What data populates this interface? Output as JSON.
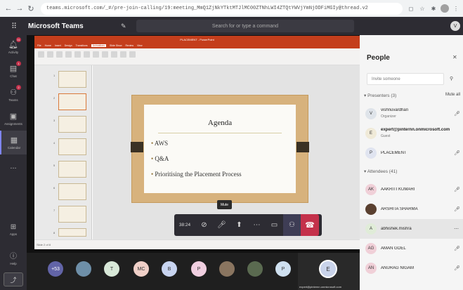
{
  "browser": {
    "url": "teams.microsoft.com/_#/pre-join-calling/19:meeting_MmQ1ZjNkYTktMTJlMC00ZTNhLWI4ZTQtYWVjYmNjODFiMGIy@thread.v2"
  },
  "teams_header": {
    "app_title": "Microsoft Teams",
    "search_placeholder": "Search for or type a command",
    "user_initial": "V"
  },
  "rail": {
    "items": [
      {
        "label": "Activity",
        "icon": "bell-icon",
        "badge": "11"
      },
      {
        "label": "Chat",
        "icon": "chat-icon",
        "badge": "1"
      },
      {
        "label": "Teams",
        "icon": "teams-icon",
        "badge": "2"
      },
      {
        "label": "Assignments",
        "icon": "assignments-icon",
        "badge": ""
      },
      {
        "label": "Calendar",
        "icon": "calendar-icon",
        "badge": ""
      },
      {
        "label": "...",
        "icon": "more-icon",
        "badge": ""
      }
    ],
    "apps_label": "Apps",
    "help_label": "Help"
  },
  "ppt": {
    "title_text": "PLACEMENT - PowerPoint",
    "tabs": [
      "File",
      "Home",
      "Insert",
      "Design",
      "Transitions",
      "Animations",
      "Slide Show",
      "Review",
      "View"
    ],
    "active_tab": "Animations",
    "thumbnails": [
      "1",
      "2",
      "3",
      "4",
      "5",
      "6",
      "7",
      "8"
    ],
    "status_text": "Slide 2 of 8"
  },
  "slide": {
    "title": "Agenda",
    "bullets": [
      "AWS",
      "Q&A",
      "Prioritising the Placement Process"
    ]
  },
  "call_controls": {
    "timer": "38:24",
    "tooltip": "Mute"
  },
  "strip": {
    "overflow_count": "+53",
    "bubbles": [
      {
        "initial": "",
        "color": "#6e8fa8"
      },
      {
        "initial": "T",
        "color": "#d8e8d8"
      },
      {
        "initial": "MC",
        "color": "#f0d0c8"
      },
      {
        "initial": "B",
        "color": "#c8d4f0"
      },
      {
        "initial": "P",
        "color": "#f0cfe0"
      },
      {
        "initial": "",
        "color": "#8a7560"
      },
      {
        "initial": "",
        "color": "#5a6a50"
      },
      {
        "initial": "P",
        "color": "#cfe0f0"
      }
    ],
    "self_initial": "E",
    "self_label": "expert@pinternn.onmicrosoft.com"
  },
  "pane": {
    "title": "People",
    "invite_placeholder": "Invite someone",
    "presenters_header": "Presenters (3)",
    "mute_all": "Mute all",
    "attendees_header": "Attendees (41)",
    "presenters": [
      {
        "name": "vishnuvardhan",
        "role": "Organizer",
        "initial": "V",
        "color": "#dfe4ea"
      },
      {
        "name": "expert@pinternn.onmicrosoft.com",
        "role": "Guest",
        "initial": "E",
        "color": "#f0ead8"
      },
      {
        "name": "PLACEMENT",
        "role": "",
        "initial": "P",
        "color": "#e0e4f0"
      }
    ],
    "attendees": [
      {
        "name": "AAKRITI KUMARI",
        "initial": "AK",
        "color": "#f0d0d8"
      },
      {
        "name": "ARSHITA SHARMA",
        "initial": "",
        "color": "#5a4030"
      },
      {
        "name": "abhishek.mishra",
        "initial": "A",
        "color": "#e0ecd8"
      },
      {
        "name": "AMAN GOEL",
        "initial": "AG",
        "color": "#f0d0d8"
      },
      {
        "name": "ANURAG NIGAM",
        "initial": "AN",
        "color": "#f0d0d8"
      }
    ]
  }
}
